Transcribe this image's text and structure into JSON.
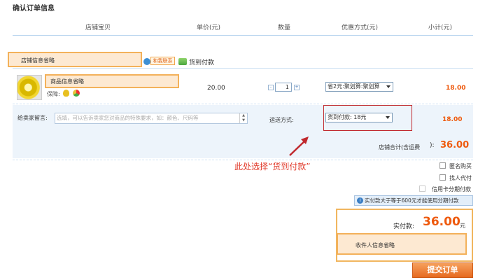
{
  "page_title": "确认订单信息",
  "table_headers": {
    "shop_item": "店铺宝贝",
    "unit_price": "单价(元)",
    "quantity": "数量",
    "discount": "优惠方式(元)",
    "subtotal": "小计(元)"
  },
  "shop": {
    "name_placeholder": "店铺信息省略",
    "contact_label": "和我联系",
    "cod_label": "货到付款"
  },
  "item": {
    "name_placeholder": "商品信息省略",
    "guarantee_label": "保障:",
    "unit_price": "20.00",
    "quantity": "1",
    "qty_minus": "-",
    "qty_plus": "+",
    "discount_selected": "省2元:聚划算:聚划算",
    "subtotal": "18.00"
  },
  "message": {
    "label": "给卖家留言:",
    "placeholder": "选填，可以告诉卖家您对商品的特殊要求，如：颜色、尺码等"
  },
  "shipping": {
    "label": "运送方式:",
    "selected": "货到付款: 18元",
    "subtotal": "18.00"
  },
  "shop_total": {
    "label": "店铺合计(含运费",
    "close_paren": "):",
    "value": "36.00"
  },
  "annotation": {
    "text": "此处选择“货到付款”",
    "color": "#e13a2a"
  },
  "options": {
    "anonymous": "匿名购买",
    "proxy_pay": "找人代付",
    "installment": "信用卡分期付款"
  },
  "info_bar": {
    "icon": "info-icon",
    "text": "实付款大于等于600元才能使用分期付款"
  },
  "payment": {
    "label": "实付款:",
    "value": "36.00",
    "unit": "元",
    "recipient_placeholder": "收件人信息省略"
  },
  "submit_label": "提交订单",
  "colors": {
    "accent_orange": "#ee5a0e",
    "highlight_fill": "#fde9d2",
    "highlight_border": "#f3b15a",
    "red_frame": "#c0282d"
  }
}
